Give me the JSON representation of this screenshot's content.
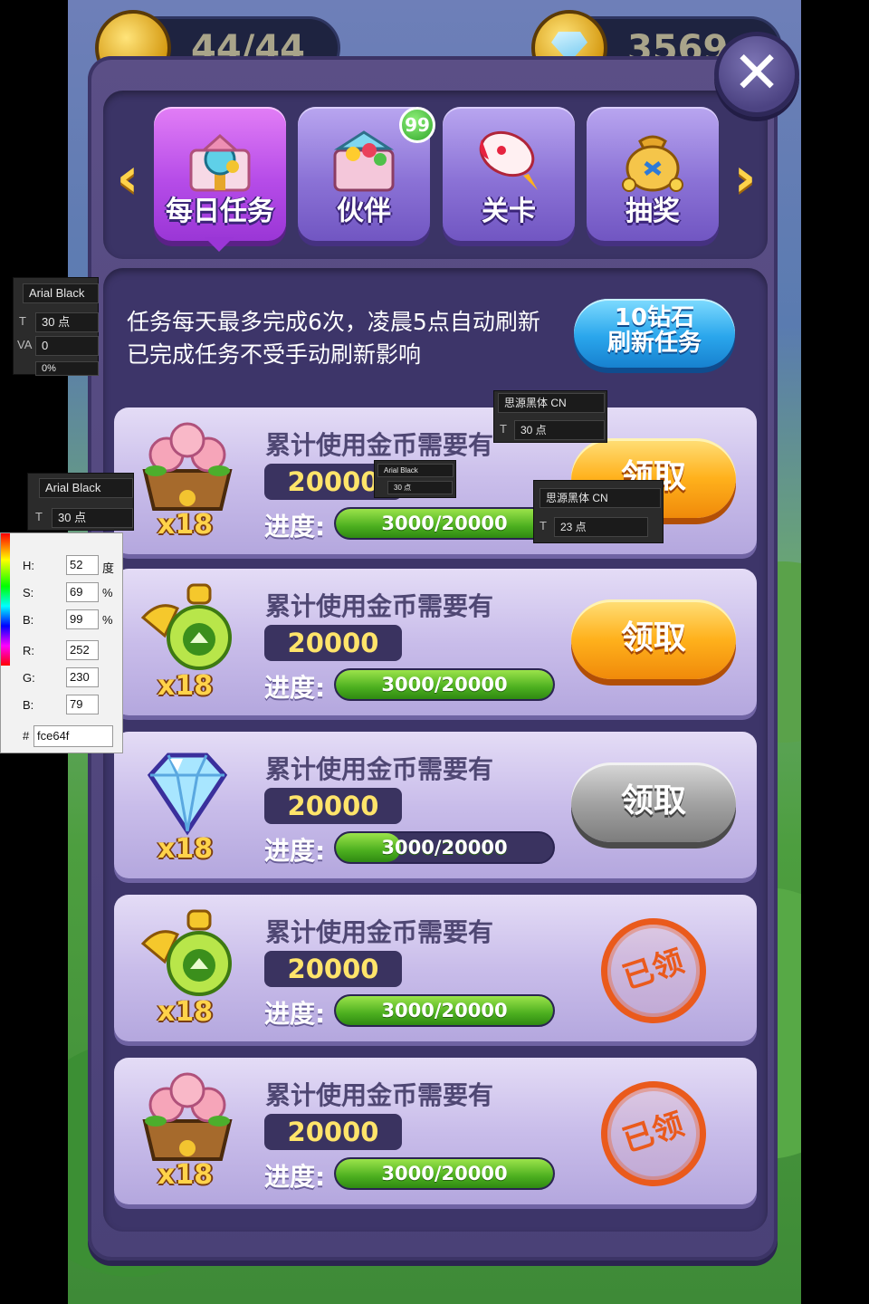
{
  "currency": {
    "stamina": "44/44",
    "diamonds": "3569"
  },
  "tabs": [
    {
      "label": "每日任务",
      "icon": "gift-box-icon",
      "active": true
    },
    {
      "label": "伙伴",
      "icon": "candy-gift-icon",
      "active": false
    },
    {
      "label": "关卡",
      "icon": "rocket-icon",
      "active": false
    },
    {
      "label": "抽奖",
      "icon": "money-bag-icon",
      "active": false
    }
  ],
  "badge": "99",
  "description": {
    "line1": "任务每天最多完成6次，凌晨5点自动刷新",
    "line2": "已完成任务不受手动刷新影响"
  },
  "refresh_button": {
    "line1": "10钻石",
    "line2": "刷新任务"
  },
  "tasks": [
    {
      "reward_icon": "peach-basket-icon",
      "reward_qty": "x18",
      "title": "累计使用金币需要有",
      "amount": "20000",
      "progress_label": "进度:",
      "progress_text": "3000/20000",
      "progress": 1.0,
      "state": "claim",
      "claim_label": "领取"
    },
    {
      "reward_icon": "potion-bottle-icon",
      "reward_qty": "x18",
      "title": "累计使用金币需要有",
      "amount": "20000",
      "progress_label": "进度:",
      "progress_text": "3000/20000",
      "progress": 1.0,
      "state": "claim",
      "claim_label": "领取"
    },
    {
      "reward_icon": "diamond-icon",
      "reward_qty": "x18",
      "title": "累计使用金币需要有",
      "amount": "20000",
      "progress_label": "进度:",
      "progress_text": "3000/20000",
      "progress": 0.3,
      "state": "disabled",
      "claim_label": "领取"
    },
    {
      "reward_icon": "potion-bottle-icon",
      "reward_qty": "x18",
      "title": "累计使用金币需要有",
      "amount": "20000",
      "progress_label": "进度:",
      "progress_text": "3000/20000",
      "progress": 1.0,
      "state": "claimed",
      "claim_label": "已领"
    },
    {
      "reward_icon": "peach-basket-icon",
      "reward_qty": "x18",
      "title": "累计使用金币需要有",
      "amount": "20000",
      "progress_label": "进度:",
      "progress_text": "3000/20000",
      "progress": 1.0,
      "state": "claimed",
      "claim_label": "已领"
    }
  ],
  "colors": {
    "claim_orange": "#ffb11c",
    "progress_green": "#4caf1f",
    "qty_yellow": "#fce64f",
    "stamp_red": "#ea5a1c"
  },
  "overlays": {
    "ps1": {
      "font": "Arial Black",
      "size": "30 点",
      "tracking": "0",
      "scale": "0%"
    },
    "ps2": {
      "font": "思源黑体 CN",
      "size": "30 点"
    },
    "ps3": {
      "font": "Arial Black",
      "size": "30 点"
    },
    "ps4": {
      "font": "Arial Black",
      "size": "30 点"
    },
    "ps5": {
      "font": "思源黑体 CN",
      "size": "23 点"
    },
    "picker": {
      "h_label": "H:",
      "h": "52",
      "h_unit": "度",
      "s_label": "S:",
      "s": "69",
      "s_unit": "%",
      "b_label": "B:",
      "b": "99",
      "b_unit": "%",
      "r_label": "R:",
      "r": "252",
      "g_label": "G:",
      "g": "230",
      "bl_label": "B:",
      "bl": "79",
      "hash": "#",
      "hex": "fce64f"
    }
  }
}
